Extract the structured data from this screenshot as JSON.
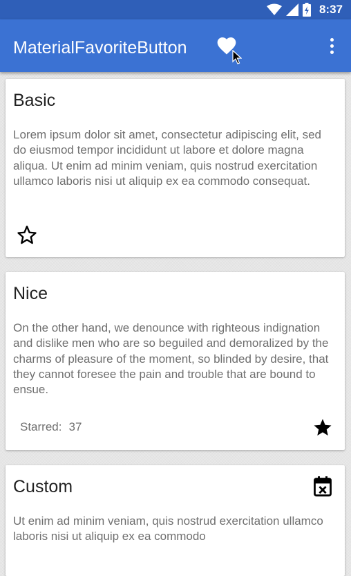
{
  "status_bar": {
    "time": "8:37",
    "icons": [
      "wifi-icon",
      "signal-icon",
      "battery-icon"
    ]
  },
  "app_bar": {
    "title": "MaterialFavoriteButton",
    "actions": [
      "heart-icon",
      "overflow-menu-icon"
    ],
    "background": "#3b72d3",
    "status_background": "#2f5fb8"
  },
  "cards": [
    {
      "title": "Basic",
      "body": "Lorem ipsum dolor sit amet, consectetur adipiscing elit, sed do eiusmod tempor incididunt ut labore et dolore magna aliqua. Ut enim ad minim veniam, quis nostrud exercitation ullamco laboris nisi ut aliquip ex ea commodo consequat.",
      "favorite_icon": "star-outline-icon",
      "favorite": false
    },
    {
      "title": "Nice",
      "body": "On the other hand, we denounce with righteous indignation and dislike men who are so beguiled and demoralized by the charms of pleasure of the moment, so blinded by desire, that they cannot foresee the pain and trouble that are bound to ensue.",
      "starred_label": "Starred:",
      "starred_count": "37",
      "favorite_icon": "star-filled-icon",
      "favorite": true
    },
    {
      "title": "Custom",
      "body": "Ut enim ad minim veniam, quis nostrud exercitation ullamco laboris nisi ut aliquip ex ea commodo",
      "favorite_icon": "calendar-remove-icon"
    }
  ]
}
